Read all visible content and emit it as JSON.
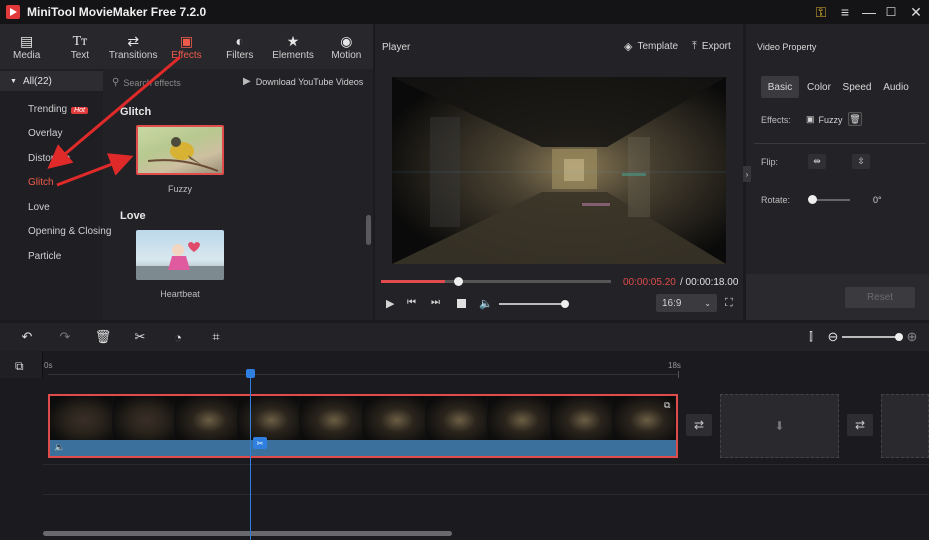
{
  "app": {
    "title": "MiniTool MovieMaker Free 7.2.0"
  },
  "toolbar": {
    "items": [
      {
        "label": "Media",
        "icon": "media-icon"
      },
      {
        "label": "Text",
        "icon": "text-icon"
      },
      {
        "label": "Transitions",
        "icon": "transitions-icon"
      },
      {
        "label": "Effects",
        "icon": "effects-icon"
      },
      {
        "label": "Filters",
        "icon": "filters-icon"
      },
      {
        "label": "Elements",
        "icon": "elements-icon"
      },
      {
        "label": "Motion",
        "icon": "motion-icon"
      }
    ]
  },
  "categories": {
    "all": "All(22)",
    "items": [
      "Trending",
      "Overlay",
      "Distortion",
      "Glitch",
      "Love",
      "Opening & Closing",
      "Particle"
    ],
    "hot": "Hot",
    "active": "Glitch"
  },
  "effects": {
    "search_placeholder": "Search effects",
    "download": "Download YouTube Videos",
    "sections": [
      {
        "title": "Glitch",
        "items": [
          "Fuzzy"
        ]
      },
      {
        "title": "Love",
        "items": [
          "Heartbeat"
        ]
      }
    ]
  },
  "player": {
    "title": "Player",
    "template": "Template",
    "export": "Export",
    "current_time": "00:00:05.20",
    "total_time": "/ 00:00:18.00",
    "aspect": "16:9",
    "progress": 0.28,
    "volume": 0.65
  },
  "props": {
    "title": "Video Property",
    "tabs": [
      "Basic",
      "Color",
      "Speed",
      "Audio"
    ],
    "effects_label": "Effects:",
    "effect_name": "Fuzzy",
    "flip_label": "Flip:",
    "rotate_label": "Rotate:",
    "rotate_value": "0°",
    "reset": "Reset"
  },
  "timeline": {
    "ruler_start": "0s",
    "ruler_end": "18s",
    "zoom": 0.85
  },
  "colors": {
    "accent": "#f05b4b",
    "playhead": "#2f7fe0",
    "clip_border": "#e04b4b"
  }
}
